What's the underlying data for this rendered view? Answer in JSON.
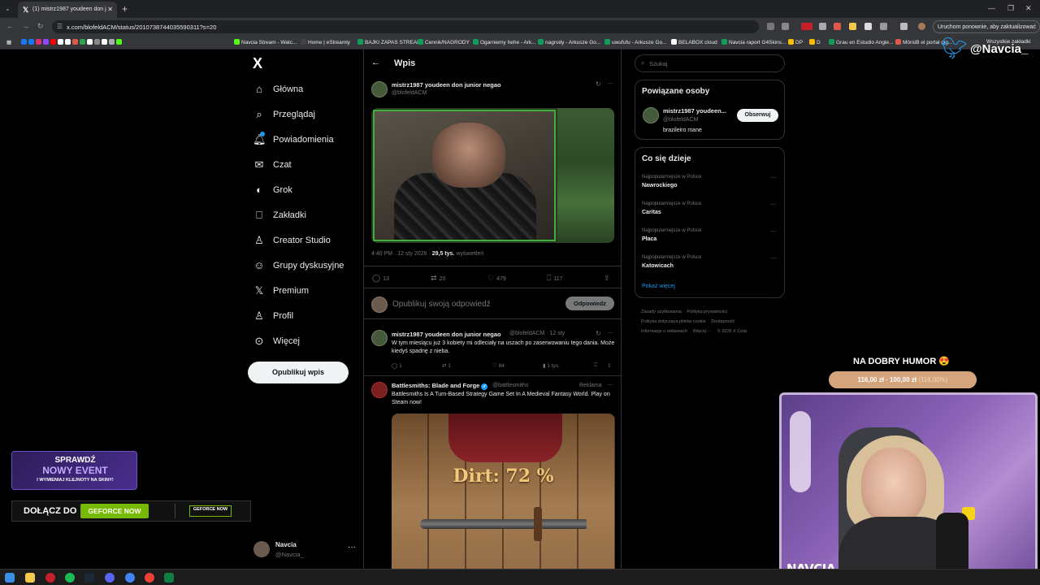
{
  "browser": {
    "tab_title": "(1) mistrz1987 youdeen don j",
    "url": "x.com/blofeldACM/status/2010738744035590311?s=20",
    "update_button": "Uruchom ponownie, aby zaktualizować",
    "bookmarks": [
      "Navcia Stream - Watc...",
      "Home | eStreamly",
      "BAJKI ZAPAS STREAM",
      "Cennik/NAGRODY",
      "Ogarniemy hehe - Ark...",
      "nagrody - Arkusze Go...",
      "uwufufu - Arkusze Go...",
      "BELABOX cloud",
      "Navcia raport G4Skins...",
      "DP",
      "D",
      "Grau en Estudio Angle...",
      "MönüB el portal dig..."
    ],
    "bookmarks_all": "Wszystkie zakładki"
  },
  "sidebar": {
    "logo": "X",
    "items": [
      {
        "label": "Główna",
        "icon": "home-icon"
      },
      {
        "label": "Przeglądaj",
        "icon": "search-icon"
      },
      {
        "label": "Powiadomienia",
        "icon": "bell-icon"
      },
      {
        "label": "Czat",
        "icon": "mail-icon"
      },
      {
        "label": "Grok",
        "icon": "grok-icon"
      },
      {
        "label": "Zakładki",
        "icon": "bookmark-icon"
      },
      {
        "label": "Creator Studio",
        "icon": "flask-icon"
      },
      {
        "label": "Grupy dyskusyjne",
        "icon": "people-icon"
      },
      {
        "label": "Premium",
        "icon": "x-icon"
      },
      {
        "label": "Profil",
        "icon": "person-icon"
      },
      {
        "label": "Więcej",
        "icon": "more-circle-icon"
      }
    ],
    "publish": "Opublikuj wpis",
    "account": {
      "name": "Navcia",
      "handle": "@Navcia_"
    }
  },
  "post": {
    "header": "Wpis",
    "author": "mistrz1987 youdeen don junior negao",
    "handle": "@blofeldACM",
    "time": "4:40 PM · 12 sty 2026 ·",
    "views": "29,5 tys.",
    "views_label": "wyświetleń",
    "replies": "13",
    "reposts": "20",
    "likes": "479",
    "bookmarks": "117",
    "reply_placeholder": "Opublikuj swoją odpowiedź",
    "reply_button": "Odpowiedz"
  },
  "reply": {
    "author": "mistrz1987 youdeen don junior negao",
    "handle_time": "@blofeldACM · 12 sty",
    "text": "W tym miesiącu już 3 kobiety mi odleciały na uszach po zaserwowaniu tego dania. Może kiedyś spadnę z nieba.",
    "replies": "1",
    "reposts": "1",
    "likes": "84",
    "views": "1 tys."
  },
  "ad": {
    "author": "Battlesmiths: Blade and Forge",
    "handle": "@battlesmiths",
    "label": "Reklama",
    "text": "Battlesmiths Is A Turn-Based Strategy Game Set In A Medieval Fantasy World. Play on Steam now!",
    "image_text": "Dirt: 72 %"
  },
  "right": {
    "search_placeholder": "Szukaj",
    "related_title": "Powiązane osoby",
    "related_name": "mistrz1987 youdeen...",
    "related_handle": "@blofeldACM",
    "related_bio": "brazileiro mane",
    "follow_button": "Obserwuj",
    "trends_title": "Co się dzieje",
    "trends": [
      {
        "category": "Najpopularniejsze w Polsce",
        "name": "Nawrockiego"
      },
      {
        "category": "Najpopularniejsze w Polsce",
        "name": "Caritas"
      },
      {
        "category": "Najpopularniejsze w Polsce",
        "name": "Płaca"
      },
      {
        "category": "Najpopularniejsze w Polsce",
        "name": "Katowicach"
      }
    ],
    "show_more": "Pokaż więcej",
    "footer": [
      "Zasady użytkowania",
      "Polityka prywatności",
      "Polityka dotycząca plików cookie",
      "Dostępność",
      "Informacje o reklamach",
      "Więcej ···",
      "© 2026 X Corp."
    ]
  },
  "overlay": {
    "handle": "@Navcia_",
    "goal_title": "NA DOBRY HUMOR 😍",
    "goal_amount": "116,00 zł · 100,00 zł",
    "goal_percent": "(116,00%)",
    "goal_progress": 1.0,
    "cam_name": "NAVCIA",
    "event_line1": "SPRAWDŹ",
    "event_line2": "NOWY EVENT",
    "event_line3": "I WYMIENIAJ KLEJNOTY NA SKINY!",
    "gf_join": "DOŁĄCZ DO",
    "gf_now": "GEFORCE NOW",
    "gf_logo": "GEFORCE NOW"
  },
  "colors": {
    "accent": "#1d9bf0",
    "bg": "#000000",
    "border": "#2f3336",
    "geforce": "#76b900"
  }
}
